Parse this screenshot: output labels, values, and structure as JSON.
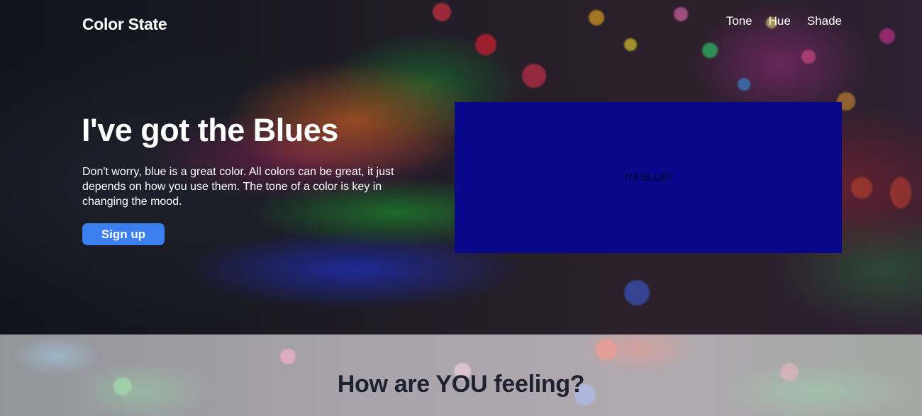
{
  "nav": {
    "brand": "Color State",
    "links": [
      "Tone",
      "Hue",
      "Shade"
    ]
  },
  "hero": {
    "title": "I've got the Blues",
    "text": "Don't worry, blue is a great color. All colors can be great, it just depends on how you use them. The tone of a color is key in changing the mood.",
    "signup_label": "Sign up",
    "panel_label": "I'M BLUE!"
  },
  "feeling": {
    "title": "How are YOU feeling?"
  },
  "colors": {
    "accent": "#3b7ff0",
    "panel": "#09088a"
  }
}
